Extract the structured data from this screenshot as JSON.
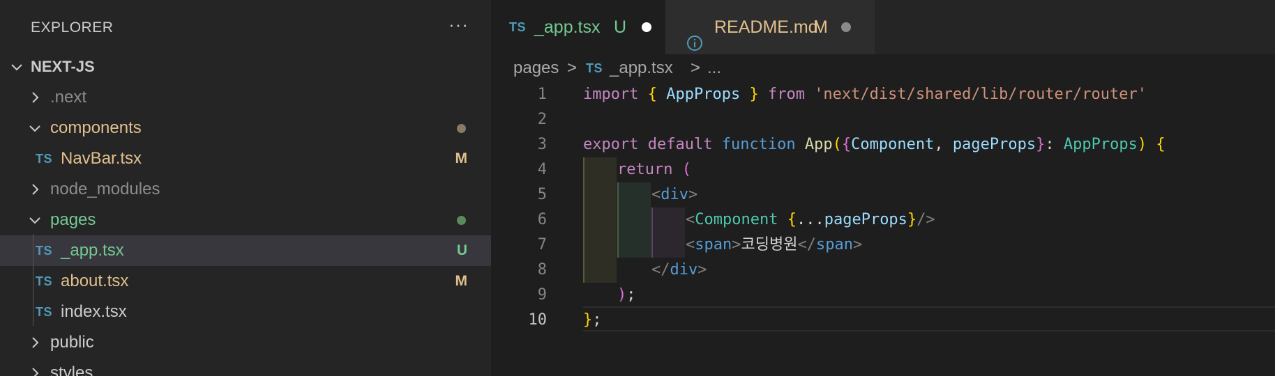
{
  "explorer": {
    "title": "EXPLORER",
    "more": "···",
    "project": "NEXT-JS",
    "items": [
      {
        "label": ".next",
        "kind": "folder",
        "expanded": false,
        "badge": ""
      },
      {
        "label": "components",
        "kind": "folder",
        "expanded": true,
        "badge": ""
      },
      {
        "label": "NavBar.tsx",
        "kind": "file",
        "badge": "M"
      },
      {
        "label": "node_modules",
        "kind": "folder",
        "expanded": false,
        "badge": ""
      },
      {
        "label": "pages",
        "kind": "folder",
        "expanded": true,
        "badge": ""
      },
      {
        "label": "_app.tsx",
        "kind": "file",
        "badge": "U"
      },
      {
        "label": "about.tsx",
        "kind": "file",
        "badge": "M"
      },
      {
        "label": "index.tsx",
        "kind": "file",
        "badge": ""
      },
      {
        "label": "public",
        "kind": "folder",
        "expanded": false,
        "badge": ""
      },
      {
        "label": "styles",
        "kind": "folder",
        "expanded": false,
        "badge": ""
      }
    ],
    "ts_tag": "TS"
  },
  "tabs": [
    {
      "label": "_app.tsx",
      "status": "U",
      "icon": "typescript-icon",
      "active": true
    },
    {
      "label": "README.md",
      "status": "M",
      "icon": "info-icon",
      "active": false
    }
  ],
  "breadcrumb": {
    "folder": "pages",
    "sep": ">",
    "ts": "TS",
    "file": "_app.tsx",
    "more": "..."
  },
  "editor": {
    "line_numbers": [
      "1",
      "2",
      "3",
      "4",
      "5",
      "6",
      "7",
      "8",
      "9",
      "10"
    ],
    "active_line": "10",
    "code": {
      "l1": {
        "import": "import",
        "ob": "{",
        "name": "AppProps",
        "cb": "}",
        "from": "from",
        "path": "'next/dist/shared/lib/router/router'"
      },
      "l3": {
        "export": "export",
        "default": "default",
        "function": "function",
        "fname": "App",
        "op": "(",
        "ob": "{",
        "p1": "Component",
        "comma": ",",
        "p2": "pageProps",
        "cb": "}",
        "colon": ":",
        "type": "AppProps",
        "cp": ")",
        "body": "{"
      },
      "l4": {
        "ret": "return",
        "op": "("
      },
      "l5": {
        "open": "<",
        "tag": "div",
        "close": ">"
      },
      "l6": {
        "open": "<",
        "tag": "Component",
        "ob": "{",
        "spread": "...",
        "prop": "pageProps",
        "cb": "}",
        "close": "/>"
      },
      "l7": {
        "open": "<",
        "tag": "span",
        "gt": ">",
        "text": "코딩병원",
        "lt": "</",
        "tag2": "span",
        "close": ">"
      },
      "l8": {
        "open": "</",
        "tag": "div",
        "close": ">"
      },
      "l9": {
        "cp": ")",
        "semi": ";"
      },
      "l10": {
        "cb": "}",
        "semi": ";"
      }
    }
  },
  "colors": {
    "modified": "#e2c08d",
    "untracked": "#73c991",
    "folder_dot_components": "#8b7a63",
    "folder_dot_pages": "#5c8a5e"
  }
}
